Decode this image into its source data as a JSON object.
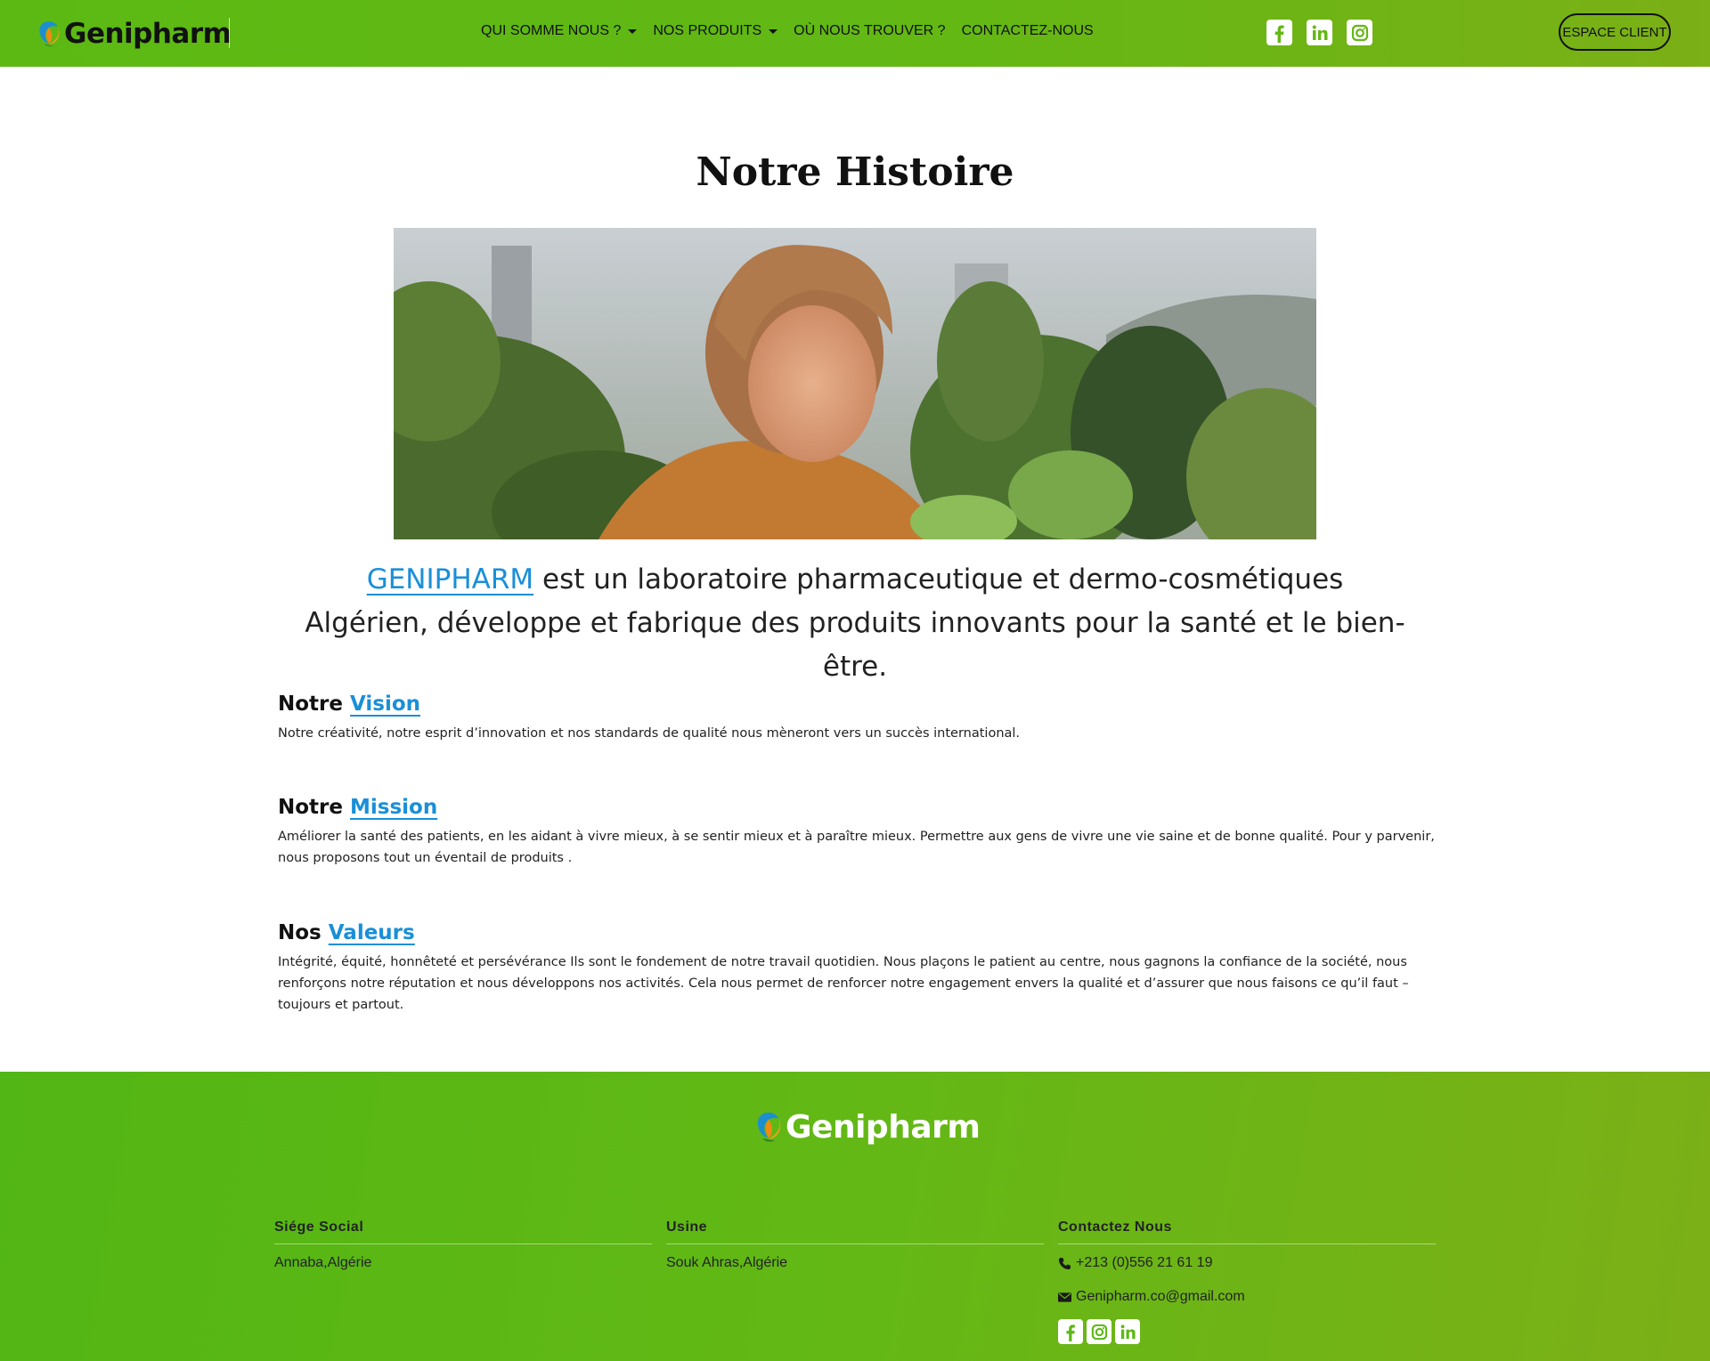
{
  "header": {
    "brand": "Genipharm",
    "nav": [
      {
        "label": "QUI SOMME NOUS ?",
        "dropdown": true
      },
      {
        "label": "NOS PRODUITS",
        "dropdown": true
      },
      {
        "label": "OÙ NOUS TROUVER ?",
        "dropdown": false
      },
      {
        "label": "CONTACTEZ-NOUS",
        "dropdown": false
      }
    ],
    "social": [
      "facebook-icon",
      "linkedin-icon",
      "instagram-icon"
    ],
    "client_button": "ESPACE CLIENT"
  },
  "main": {
    "title": "Notre Histoire",
    "intro_brand": "GENIPHARM",
    "intro_text": " est un laboratoire pharmaceutique et dermo-cosmétiques Algérien, développe et fabrique des produits innovants pour la santé et le bien-être.",
    "sections": [
      {
        "prefix": "Notre",
        "highlight": "Vision",
        "text": "Notre créativité, notre esprit d’innovation et nos standards de qualité nous mèneront vers un succès international."
      },
      {
        "prefix": "Notre",
        "highlight": "Mission",
        "text": "Améliorer la santé des patients, en les aidant à vivre mieux, à se sentir mieux et à paraître mieux. Permettre aux gens de vivre une vie saine et de bonne qualité. Pour y parvenir, nous proposons tout un éventail de produits ."
      },
      {
        "prefix": "Nos",
        "highlight": "Valeurs",
        "text": "Intégrité, équité, honnêteté et persévérance Ils sont le fondement de notre travail quotidien. Nous plaçons le patient au centre, nous gagnons la confiance de la société, nous renforçons notre réputation et nous développons nos activités. Cela nous permet de renforcer notre engagement envers la qualité et d’assurer que nous faisons ce qu’il faut – toujours et partout."
      }
    ]
  },
  "footer": {
    "brand": "Genipharm",
    "columns": [
      {
        "title": "Siége Social",
        "lines": [
          "Annaba,Algérie"
        ]
      },
      {
        "title": "Usine",
        "lines": [
          "Souk Ahras,Algérie"
        ]
      },
      {
        "title": "Contactez Nous",
        "phone": "+213 (0)556 21 61 19",
        "email": "Genipharm.co@gmail.com"
      }
    ],
    "social": [
      "facebook-icon",
      "instagram-icon",
      "linkedin-icon"
    ]
  },
  "colors": {
    "header_green": "#63b814",
    "link_blue": "#1a8fd8",
    "footer_green": "#5cb814"
  }
}
